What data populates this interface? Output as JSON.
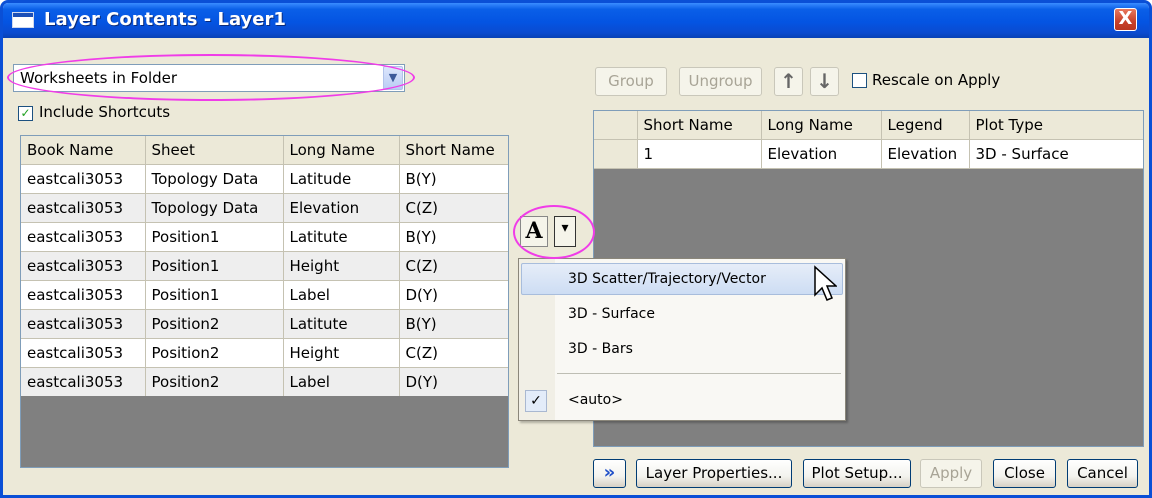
{
  "window": {
    "title": "Layer Contents - Layer1",
    "close_label": "X"
  },
  "left": {
    "filter_value": "Worksheets in Folder",
    "include_shortcuts_label": "Include Shortcuts",
    "columns": [
      "Book Name",
      "Sheet",
      "Long Name",
      "Short Name"
    ],
    "rows": [
      [
        "eastcali3053",
        "Topology Data",
        "Latitude",
        "B(Y)"
      ],
      [
        "eastcali3053",
        "Topology Data",
        "Elevation",
        "C(Z)"
      ],
      [
        "eastcali3053",
        "Position1",
        "Latitute",
        "B(Y)"
      ],
      [
        "eastcali3053",
        "Position1",
        "Height",
        "C(Z)"
      ],
      [
        "eastcali3053",
        "Position1",
        "Label",
        "D(Y)"
      ],
      [
        "eastcali3053",
        "Position2",
        "Latitute",
        "B(Y)"
      ],
      [
        "eastcali3053",
        "Position2",
        "Height",
        "C(Z)"
      ],
      [
        "eastcali3053",
        "Position2",
        "Label",
        "D(Y)"
      ]
    ]
  },
  "middle": {
    "add_button_label": "A",
    "dropdown_arrow": "▾"
  },
  "right": {
    "group_label": "Group",
    "ungroup_label": "Ungroup",
    "rescale_label": "Rescale on Apply",
    "columns": [
      "Short Name",
      "Long Name",
      "Legend",
      "Plot Type"
    ],
    "rows": [
      [
        "1",
        "Elevation",
        "Elevation",
        "3D - Surface"
      ]
    ]
  },
  "plot_menu": {
    "items": [
      "3D Scatter/Trajectory/Vector",
      "3D - Surface",
      "3D - Bars"
    ],
    "auto_label": "<auto>"
  },
  "footer": {
    "expand_label": "»",
    "layer_properties_label": "Layer Properties...",
    "plot_setup_label": "Plot Setup...",
    "apply_label": "Apply",
    "close_label": "Close",
    "cancel_label": "Cancel"
  },
  "colors": {
    "titlebar": "#0454E2",
    "highlight": "#F03CE8",
    "empty_grid": "#808080"
  }
}
